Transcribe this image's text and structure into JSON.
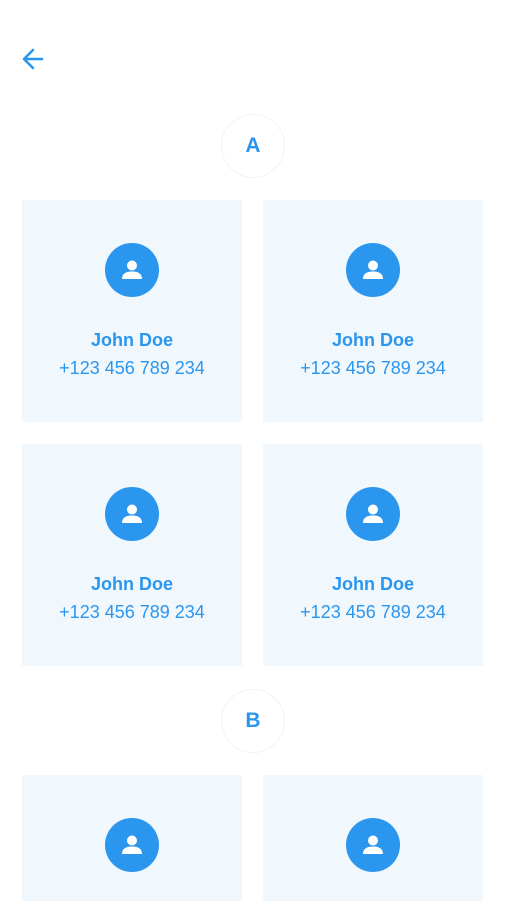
{
  "header": {
    "back_icon": "arrow-left-icon"
  },
  "colors": {
    "accent": "#2b96ee",
    "card_background": "#f0f7fd",
    "page_background": "#ffffff"
  },
  "sections": [
    {
      "letter": "A",
      "contacts": [
        {
          "name": "John Doe",
          "phone": "+123 456 789 234",
          "icon": "person-icon"
        },
        {
          "name": "John Doe",
          "phone": "+123 456 789 234",
          "icon": "person-icon"
        },
        {
          "name": "John Doe",
          "phone": "+123 456 789 234",
          "icon": "person-icon"
        },
        {
          "name": "John Doe",
          "phone": "+123 456 789 234",
          "icon": "person-icon"
        }
      ]
    },
    {
      "letter": "B",
      "contacts": [
        {
          "icon": "person-icon"
        },
        {
          "icon": "person-icon"
        }
      ]
    }
  ]
}
